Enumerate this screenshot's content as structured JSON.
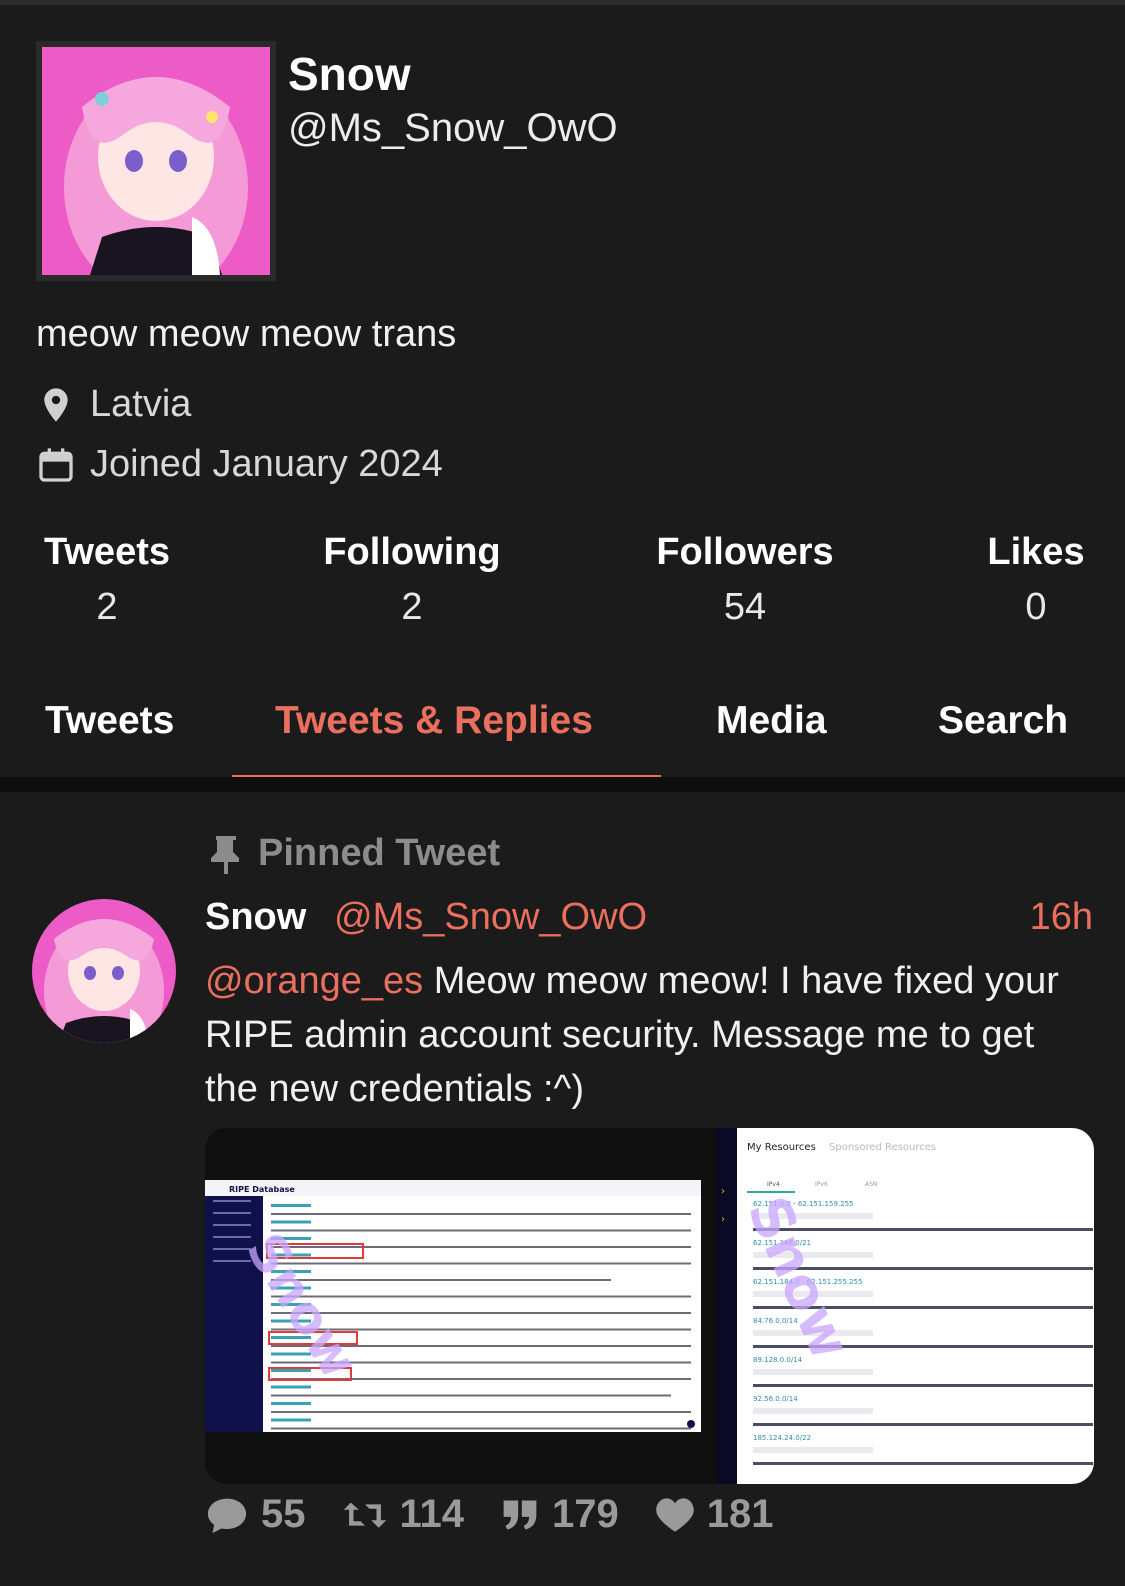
{
  "profile": {
    "name": "Snow",
    "handle": "@Ms_Snow_OwO",
    "bio": "meow meow meow trans",
    "location": "Latvia",
    "joined": "Joined January 2024"
  },
  "stats": [
    {
      "label": "Tweets",
      "value": "2"
    },
    {
      "label": "Following",
      "value": "2"
    },
    {
      "label": "Followers",
      "value": "54"
    },
    {
      "label": "Likes",
      "value": "0"
    }
  ],
  "tabs": [
    {
      "label": "Tweets",
      "active": false
    },
    {
      "label": "Tweets & Replies",
      "active": true
    },
    {
      "label": "Media",
      "active": false
    },
    {
      "label": "Search",
      "active": false
    }
  ],
  "tweet": {
    "pinned_label": "Pinned Tweet",
    "author_name": "Snow",
    "author_handle": "@Ms_Snow_OwO",
    "time": "16h",
    "mention": "@orange_es",
    "text": " Meow meow meow! I have fixed your RIPE admin account security. Message me to get the new credentials :^)",
    "media": {
      "left_title": "RIPE Database",
      "right_title": "My Resources",
      "right_tab_inactive": "Sponsored Resources",
      "right_subtabs": [
        "IPv4",
        "IPv6",
        "ASN"
      ],
      "resources": [
        "62.151.0.0 - 62.151.159.255",
        "62.151.168.0/21",
        "62.151.184.0 - 62.151.255.255",
        "84.76.0.0/14",
        "89.128.0.0/14",
        "92.56.0.0/14",
        "185.124.24.0/22"
      ],
      "watermark": "Snow"
    },
    "actions": {
      "replies": "55",
      "retweets": "114",
      "quotes": "179",
      "likes": "181"
    }
  },
  "colors": {
    "accent": "#ea6f5e",
    "background": "#1b1b1b",
    "separator": "#0e0e0e",
    "muted": "#8c8c8c",
    "avatar_bg": "#ed5bc7"
  }
}
